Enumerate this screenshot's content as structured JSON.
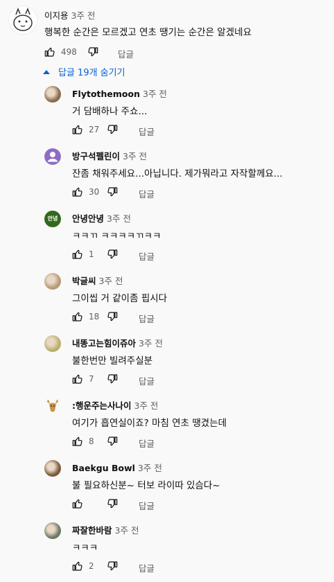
{
  "top_comment": {
    "author": "이지용",
    "time": "3주 전",
    "text": "행복한 순간은 모르겠고 연초 땡기는 순간은 알겠네요",
    "likes": "498",
    "reply_label": "답글"
  },
  "replies_toggle": {
    "label": "답글 19개 숨기기"
  },
  "replies": [
    {
      "author": "Flytothemoon",
      "time": "3주 전",
      "text": "거 담배하나 주쇼...",
      "likes": "27",
      "reply_label": "답글",
      "avatar_type": "photo",
      "avatar_color": "#8b6a4e"
    },
    {
      "author": "방구석펠린이",
      "time": "3주 전",
      "text": "잔좀 채워주세요...아닙니다. 제가뭐라고 자작할께요...",
      "likes": "30",
      "reply_label": "답글",
      "avatar_type": "default",
      "avatar_color": "#8e6cc4"
    },
    {
      "author": "안녕안녕",
      "time": "3주 전",
      "text": "ㅋㅋㄲ ㅋㅋㅋㅋㄲㅋㅋ",
      "likes": "1",
      "reply_label": "답글",
      "avatar_type": "text",
      "avatar_text": "안녕",
      "avatar_color": "#33691e"
    },
    {
      "author": "박글씨",
      "time": "3주 전",
      "text": "그이씹 거 같이좀 핍시다",
      "likes": "18",
      "reply_label": "답글",
      "avatar_type": "photo",
      "avatar_color": "#b79a78"
    },
    {
      "author": "내똥고는힘이쥬아",
      "time": "3주 전",
      "text": "불한번만 빌려주실분",
      "likes": "7",
      "reply_label": "답글",
      "avatar_type": "photo",
      "avatar_color": "#b9b06a"
    },
    {
      "author": ":행운주는사나이",
      "time": "3주 전",
      "text": "여기가 흡연실이죠? 마침 연초 땡겼는데",
      "likes": "8",
      "reply_label": "답글",
      "avatar_type": "deer",
      "avatar_color": "#c8924a"
    },
    {
      "author": "Baekgu Bowl",
      "time": "3주 전",
      "text": "불 필요하신분~ 터보 라이따 있슴다~",
      "likes": "",
      "reply_label": "답글",
      "avatar_type": "photo",
      "avatar_color": "#7a5a3a"
    },
    {
      "author": "짜잘한바람",
      "time": "3주 전",
      "text": "ㅋㅋㅋ",
      "likes": "2",
      "reply_label": "답글",
      "avatar_type": "photo",
      "avatar_color": "#6b7a66"
    }
  ],
  "icons": {
    "like": "thumbs-up-icon",
    "dislike": "thumbs-down-icon",
    "toggle": "caret-up-icon",
    "top_avatar": "cartoon-avatar-icon"
  }
}
